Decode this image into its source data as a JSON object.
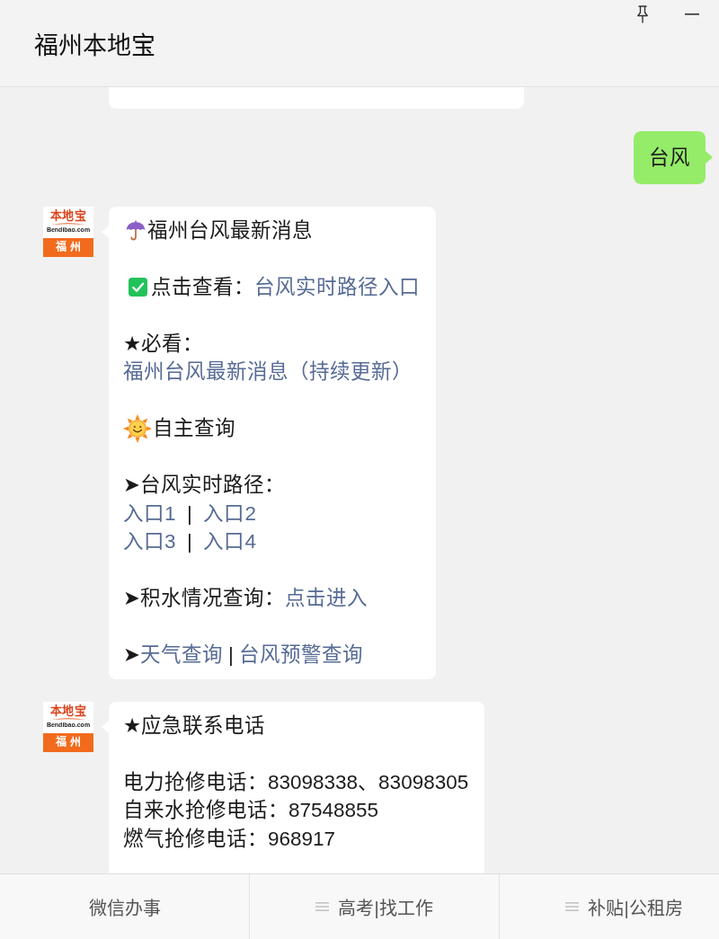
{
  "window": {
    "title": "福州本地宝"
  },
  "messages": [
    {
      "kind": "received",
      "cut_top": true
    },
    {
      "kind": "sent",
      "paragraphs": [
        {
          "lines": [
            [
              {
                "kind": "text",
                "text": "台风"
              }
            ]
          ]
        }
      ]
    },
    {
      "kind": "received",
      "avatar": {
        "logo": "本地宝",
        "domain": "Bendibao.com",
        "city": "福 州"
      },
      "paragraphs": [
        {
          "lines": [
            [
              {
                "kind": "umbrella"
              },
              {
                "kind": "text",
                "text": "福州台风最新消息"
              }
            ]
          ]
        },
        {
          "lines": [
            [
              {
                "kind": "check"
              },
              {
                "kind": "text",
                "text": "点击查看："
              },
              {
                "kind": "link",
                "text": "台风实时路径入口"
              }
            ]
          ]
        },
        {
          "lines": [
            [
              {
                "kind": "text",
                "text": "★必看："
              }
            ],
            [
              {
                "kind": "link",
                "text": "福州台风最新消息（持续更新）"
              }
            ]
          ]
        },
        {
          "lines": [
            [
              {
                "kind": "sun"
              },
              {
                "kind": "text",
                "text": "自主查询"
              }
            ]
          ]
        },
        {
          "lines": [
            [
              {
                "kind": "text",
                "text": "➤台风实时路径："
              }
            ],
            [
              {
                "kind": "link",
                "text": "入口1"
              },
              {
                "kind": "text",
                "text": "  |  "
              },
              {
                "kind": "link",
                "text": "入口2"
              }
            ],
            [
              {
                "kind": "link",
                "text": "入口3"
              },
              {
                "kind": "text",
                "text": "  |  "
              },
              {
                "kind": "link",
                "text": "入口4"
              }
            ]
          ]
        },
        {
          "lines": [
            [
              {
                "kind": "text",
                "text": "➤积水情况查询："
              },
              {
                "kind": "link",
                "text": "点击进入"
              }
            ]
          ]
        },
        {
          "lines": [
            [
              {
                "kind": "text",
                "text": "➤"
              },
              {
                "kind": "link",
                "text": "天气查询"
              },
              {
                "kind": "text",
                "text": " | "
              },
              {
                "kind": "link",
                "text": "台风预警查询"
              }
            ]
          ]
        }
      ]
    },
    {
      "kind": "received",
      "cut_bottom": true,
      "avatar": {
        "logo": "本地宝",
        "domain": "Bendibao.com",
        "city": "福 州"
      },
      "paragraphs": [
        {
          "lines": [
            [
              {
                "kind": "text",
                "text": "★应急联系电话"
              }
            ]
          ]
        },
        {
          "lines": [
            [
              {
                "kind": "text",
                "text": "电力抢修电话：83098338、83098305"
              }
            ],
            [
              {
                "kind": "text",
                "text": "自来水抢修电话：87548855"
              }
            ],
            [
              {
                "kind": "text",
                "text": "燃气抢修电话：968917"
              }
            ]
          ]
        }
      ]
    }
  ],
  "bottom_menu": [
    {
      "label": "微信办事",
      "has_submenu": false
    },
    {
      "label": "高考|找工作",
      "has_submenu": true
    },
    {
      "label": "补贴|公租房",
      "has_submenu": true
    }
  ]
}
